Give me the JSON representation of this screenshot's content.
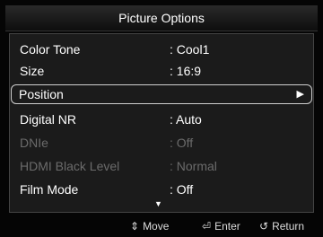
{
  "header": {
    "title": "Picture Options"
  },
  "menu": {
    "items": [
      {
        "label": "Color Tone",
        "value": ": Cool1"
      },
      {
        "label": "Size",
        "value": ": 16:9"
      },
      {
        "label": "Position",
        "arrow": "▶"
      },
      {
        "label": "Digital NR",
        "value": ": Auto"
      },
      {
        "label": "DNIe",
        "value": ": Off"
      },
      {
        "label": "HDMI Black Level",
        "value": ": Normal"
      },
      {
        "label": "Film Mode",
        "value": ": Off"
      }
    ],
    "scroll_indicator": "▼",
    "selected_index": 2,
    "disabled_indices": [
      4,
      5
    ]
  },
  "footer": {
    "move": {
      "icon": "⇕",
      "label": "Move"
    },
    "enter": {
      "icon": "⏎",
      "label": "Enter"
    },
    "return": {
      "icon": "↺",
      "label": "Return"
    }
  },
  "colors": {
    "background": "#050505",
    "panel": "#1b1b1b",
    "text": "#ffffff",
    "disabled_text": "#6b6b6b",
    "selection_border": "#cfcfcf"
  }
}
